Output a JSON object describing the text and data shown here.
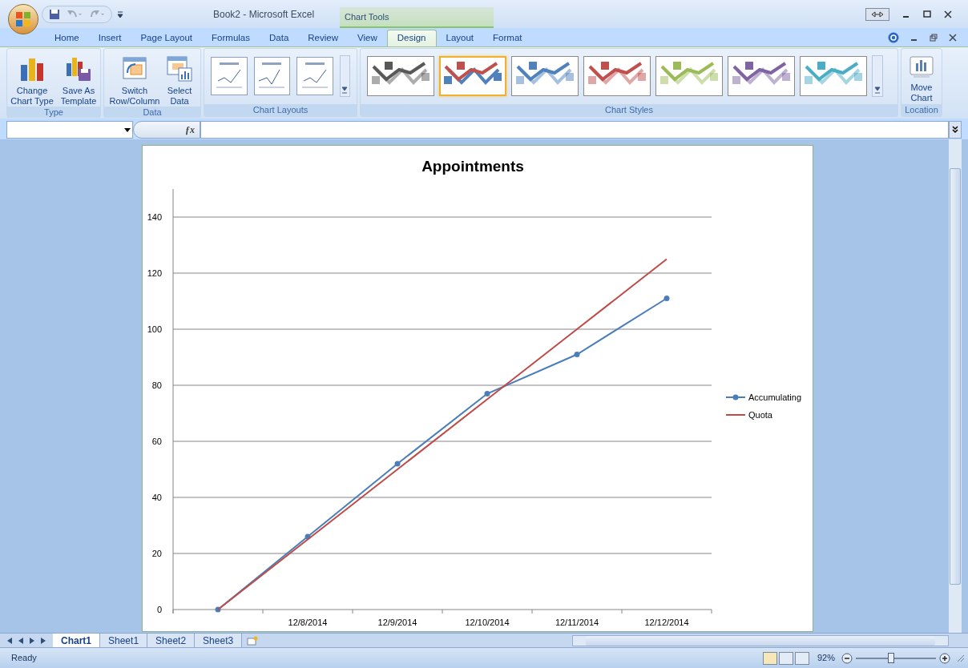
{
  "window": {
    "title": "Book2 - Microsoft Excel",
    "context_label": "Chart Tools"
  },
  "tabs": [
    {
      "label": "Home",
      "selected": false
    },
    {
      "label": "Insert",
      "selected": false
    },
    {
      "label": "Page Layout",
      "selected": false
    },
    {
      "label": "Formulas",
      "selected": false
    },
    {
      "label": "Data",
      "selected": false
    },
    {
      "label": "Review",
      "selected": false
    },
    {
      "label": "View",
      "selected": false
    },
    {
      "label": "Design",
      "selected": true
    },
    {
      "label": "Layout",
      "selected": false
    },
    {
      "label": "Format",
      "selected": false
    }
  ],
  "ribbon": {
    "groups": [
      {
        "label": "Type",
        "kind": "buttons",
        "buttons": [
          {
            "label": "Change Chart Type"
          },
          {
            "label": "Save As Template"
          }
        ]
      },
      {
        "label": "Data",
        "kind": "buttons",
        "buttons": [
          {
            "label": "Switch Row/Column"
          },
          {
            "label": "Select Data"
          }
        ]
      },
      {
        "label": "Chart Layouts",
        "kind": "layouts",
        "layouts": [
          {
            "selected": false
          },
          {
            "selected": false
          },
          {
            "selected": false
          }
        ]
      },
      {
        "label": "Chart Styles",
        "kind": "styles",
        "styles": [
          {
            "color": "#595959",
            "selected": false
          },
          {
            "color": "#c0504d",
            "selected": true
          },
          {
            "color": "#4f81bd",
            "selected": false
          },
          {
            "color": "#c0504d",
            "selected": false
          },
          {
            "color": "#9bbb59",
            "selected": false
          },
          {
            "color": "#8064a2",
            "selected": false
          },
          {
            "color": "#4bacc6",
            "selected": false
          }
        ]
      },
      {
        "label": "Location",
        "kind": "buttons",
        "buttons": [
          {
            "label": "Move Chart"
          }
        ]
      }
    ]
  },
  "formula_bar": {
    "function_label": "ƒx"
  },
  "chart": {
    "chart_data": {
      "type": "line",
      "title": "Appointments",
      "categories": [
        null,
        "12/8/2014",
        "12/9/2014",
        "12/10/2014",
        "12/11/2014",
        "12/12/2014"
      ],
      "ylim": [
        0,
        150
      ],
      "yticks": [
        0,
        20,
        40,
        60,
        80,
        100,
        120,
        140
      ],
      "grid": true,
      "legend": true,
      "series": [
        {
          "name": "Accumulating",
          "color": "#4a7ebb",
          "marker": "circle",
          "values": [
            0,
            26,
            52,
            77,
            91,
            111
          ]
        },
        {
          "name": "Quota",
          "color": "#be4b48",
          "marker": "none",
          "values": [
            0,
            25,
            50,
            75,
            100,
            125
          ]
        }
      ]
    }
  },
  "sheet_tabs": [
    {
      "label": "Chart1",
      "selected": true
    },
    {
      "label": "Sheet1",
      "selected": false
    },
    {
      "label": "Sheet2",
      "selected": false
    },
    {
      "label": "Sheet3",
      "selected": false
    }
  ],
  "status_bar": {
    "status": "Ready",
    "zoom": "92%",
    "zoom_slider": {
      "level": 0.44
    }
  }
}
